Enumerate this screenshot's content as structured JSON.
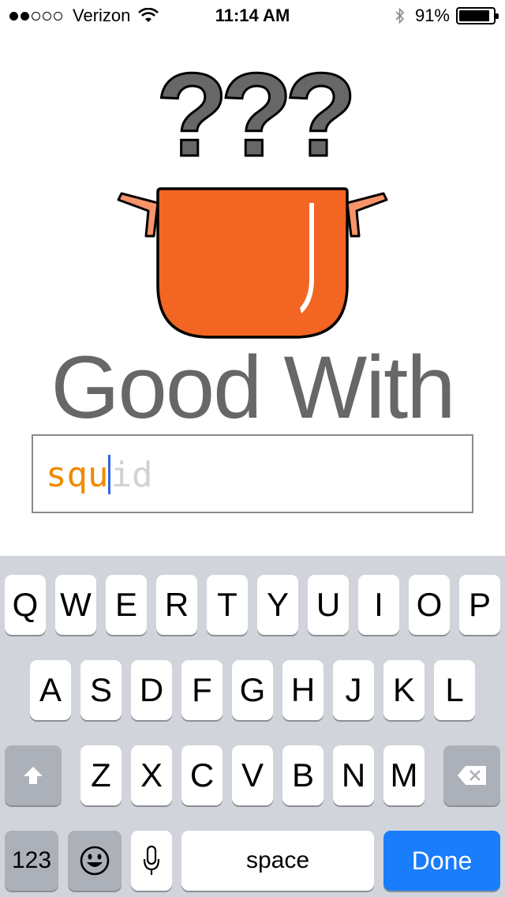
{
  "status_bar": {
    "signal_dots_filled": 2,
    "signal_dots_total": 5,
    "carrier": "Verizon",
    "time": "11:14 AM",
    "battery_percent": "91%",
    "battery_level": 0.91
  },
  "colors": {
    "pot_orange": "#f26522",
    "handle_salmon": "#f7946a",
    "question_gray": "#676767",
    "title_gray": "#676767",
    "typed_orange": "#f08a00",
    "suggest_gray": "#d2d2d2",
    "caret_blue": "#2f62e6",
    "done_blue": "#1a7dfb"
  },
  "logo": {
    "question_marks": "???",
    "icon": "cooking-pot-icon"
  },
  "title": "Good With",
  "search": {
    "typed": "squ",
    "suggestion": "id"
  },
  "keyboard": {
    "row1": [
      "Q",
      "W",
      "E",
      "R",
      "T",
      "Y",
      "U",
      "I",
      "O",
      "P"
    ],
    "row2": [
      "A",
      "S",
      "D",
      "F",
      "G",
      "H",
      "J",
      "K",
      "L"
    ],
    "row3": [
      "Z",
      "X",
      "C",
      "V",
      "B",
      "N",
      "M"
    ],
    "shift_icon": "shift-arrow-icon",
    "delete_icon": "backspace-icon",
    "numbers_label": "123",
    "emoji_icon": "emoji-icon",
    "mic_icon": "microphone-icon",
    "space_label": "space",
    "done_label": "Done"
  }
}
